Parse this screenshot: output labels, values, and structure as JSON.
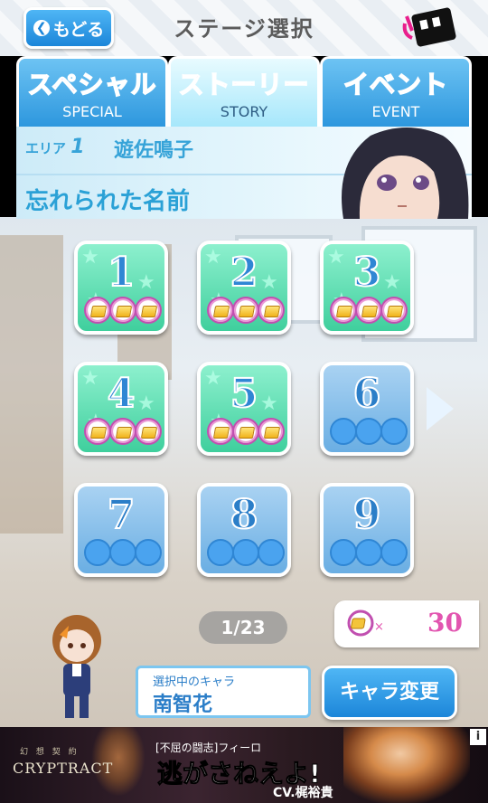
{
  "header": {
    "back_label": "もどる",
    "title": "ステージ選択"
  },
  "tabs": [
    {
      "jp": "スペシャル",
      "en": "SPECIAL",
      "active": false
    },
    {
      "jp": "ストーリー",
      "en": "STORY",
      "active": true
    },
    {
      "jp": "イベント",
      "en": "EVENT",
      "active": false
    }
  ],
  "area": {
    "prefix": "エリア",
    "number": "1",
    "character_name": "遊佐鳴子",
    "subtitle": "忘れられた名前"
  },
  "stages": [
    {
      "number": "1",
      "state": "open",
      "medals_earned": 3
    },
    {
      "number": "2",
      "state": "open",
      "medals_earned": 3
    },
    {
      "number": "3",
      "state": "open",
      "medals_earned": 3
    },
    {
      "number": "4",
      "state": "open",
      "medals_earned": 3
    },
    {
      "number": "5",
      "state": "open",
      "medals_earned": 3
    },
    {
      "number": "6",
      "state": "locked",
      "medals_earned": 0
    },
    {
      "number": "7",
      "state": "locked",
      "medals_earned": 0
    },
    {
      "number": "8",
      "state": "locked",
      "medals_earned": 0
    },
    {
      "number": "9",
      "state": "locked",
      "medals_earned": 0
    }
  ],
  "pager": {
    "text": "1/23"
  },
  "medal_count": {
    "multiplier": "×",
    "value": "30"
  },
  "selected_character": {
    "label": "選択中のキャラ",
    "name": "南智花"
  },
  "change_button_label": "キャラ変更",
  "ad": {
    "logo_small": "幻 想 契 約",
    "logo": "CRYPTRACT",
    "subtitle": "[不屈の闘志]フィーロ",
    "headline": "逃がさねえよ!",
    "cv": "CV.梶裕貴",
    "info": "i"
  },
  "colors": {
    "accent_blue": "#1c86d9",
    "pink": "#ff4fb0",
    "stage_open": "#3fcf9d",
    "stage_locked": "#6aaee3"
  }
}
